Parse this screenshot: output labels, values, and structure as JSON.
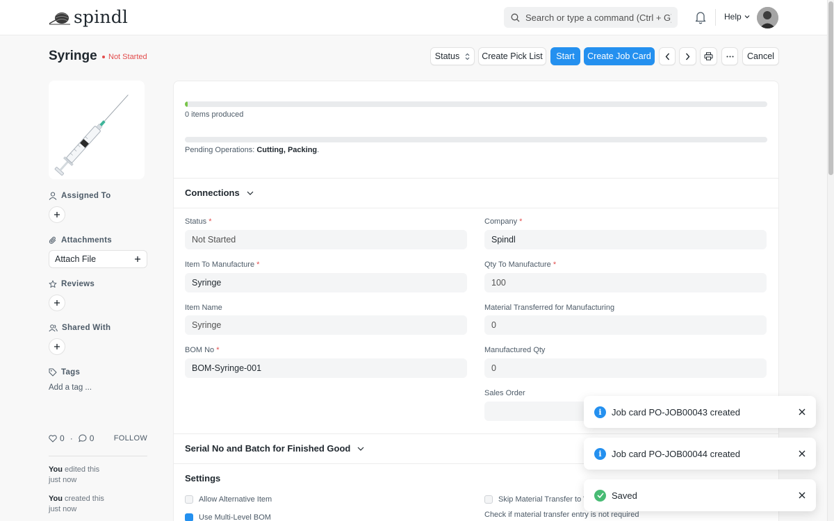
{
  "navbar": {
    "logo_text": "spindl",
    "search_placeholder": "Search or type a command (Ctrl + G)",
    "help_label": "Help"
  },
  "page": {
    "title": "Syringe",
    "status": "Not Started"
  },
  "toolbar": {
    "status_label": "Status",
    "create_pick_list": "Create Pick List",
    "start": "Start",
    "create_job_card": "Create Job Card",
    "cancel": "Cancel"
  },
  "sidebar": {
    "assigned_to": "Assigned To",
    "attachments": "Attachments",
    "attach_file": "Attach File",
    "reviews": "Reviews",
    "shared_with": "Shared With",
    "tags": "Tags",
    "add_tag": "Add a tag ...",
    "likes_count": "0",
    "comments_count": "0",
    "follow": "FOLLOW",
    "activity": [
      {
        "who": "You",
        "action": "edited this",
        "when": "just now"
      },
      {
        "who": "You",
        "action": "created this",
        "when": "just now"
      }
    ]
  },
  "progress": {
    "produced_fraction": 0.005,
    "produced_text": "0 items produced",
    "operations_fraction": 0,
    "pending_prefix": "Pending Operations: ",
    "pending_ops": "Cutting, Packing",
    "pending_suffix": "."
  },
  "sections": {
    "connections": "Connections",
    "serial_batch": "Serial No and Batch for Finished Good",
    "settings": "Settings"
  },
  "fields": {
    "status": {
      "label": "Status",
      "value": "Not Started"
    },
    "company": {
      "label": "Company",
      "value": "Spindl"
    },
    "item_to_manufacture": {
      "label": "Item To Manufacture",
      "value": "Syringe"
    },
    "qty_to_manufacture": {
      "label": "Qty To Manufacture",
      "value": "100"
    },
    "item_name": {
      "label": "Item Name",
      "value": "Syringe"
    },
    "material_transferred": {
      "label": "Material Transferred for Manufacturing",
      "value": "0"
    },
    "bom_no": {
      "label": "BOM No",
      "value": "BOM-Syringe-001"
    },
    "manufactured_qty": {
      "label": "Manufactured Qty",
      "value": "0"
    },
    "sales_order": {
      "label": "Sales Order",
      "value": ""
    }
  },
  "settings": {
    "allow_alternative_item": "Allow Alternative Item",
    "use_multi_level_bom": "Use Multi-Level BOM",
    "skip_material_transfer": "Skip Material Transfer to W",
    "skip_help": "Check if material transfer entry is not required"
  },
  "toasts": [
    {
      "type": "info",
      "message": "Job card PO-JOB00043 created"
    },
    {
      "type": "info",
      "message": "Job card PO-JOB00044 created"
    },
    {
      "type": "success",
      "message": "Saved"
    }
  ],
  "colors": {
    "primary": "#2490ef",
    "danger": "#e24c4c",
    "progress": "#78c44a",
    "success": "#48bb74"
  }
}
